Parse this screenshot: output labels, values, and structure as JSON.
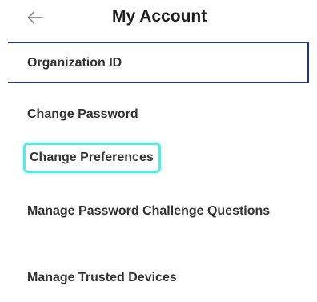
{
  "header": {
    "title": "My Account",
    "back_icon": "arrow-left-icon"
  },
  "menu": {
    "items": [
      {
        "label": "Organization ID",
        "state": "selected"
      },
      {
        "label": "Change Password"
      },
      {
        "label": "Change Preferences",
        "state": "focused"
      },
      {
        "label": "Manage Password Challenge Questions"
      },
      {
        "label": "Manage Trusted Devices"
      }
    ]
  },
  "colors": {
    "selected_border": "#1f3a6b",
    "focus_ring": "#5ee6e0",
    "text": "#333333"
  }
}
